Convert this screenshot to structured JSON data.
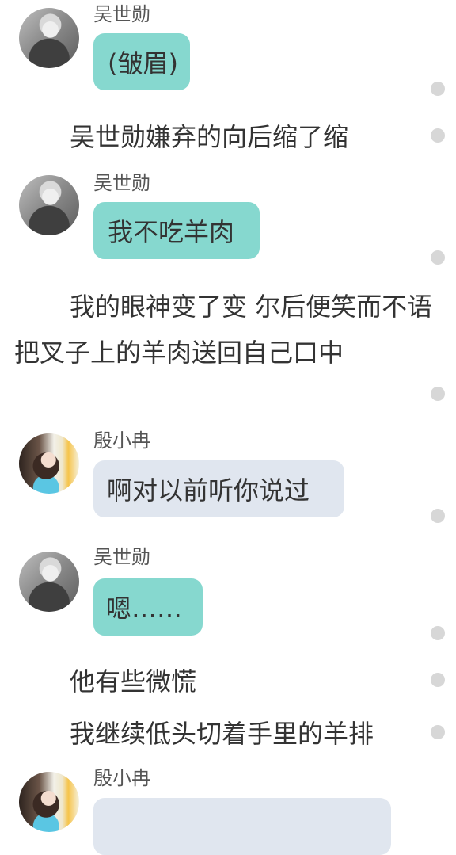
{
  "messages": [
    {
      "type": "chat",
      "speaker": "吴世勋",
      "text": "(皱眉)",
      "avatar_icon": "male-avatar-icon",
      "bubble_color": "#86d8cf"
    },
    {
      "type": "narration",
      "text": "吴世勋嫌弃的向后缩了缩"
    },
    {
      "type": "chat",
      "speaker": "吴世勋",
      "text": "我不吃羊肉",
      "avatar_icon": "male-avatar-icon",
      "bubble_color": "#86d8cf"
    },
    {
      "type": "narration",
      "text": "我的眼神变了变 尔后便笑而不语把叉子上的羊肉送回自己口中"
    },
    {
      "type": "chat",
      "speaker": "殷小冉",
      "text": "啊对以前听你说过",
      "avatar_icon": "female-avatar-icon",
      "bubble_color": "#e0e6ef"
    },
    {
      "type": "chat",
      "speaker": "吴世勋",
      "text": "嗯……",
      "avatar_icon": "male-avatar-icon",
      "bubble_color": "#86d8cf"
    },
    {
      "type": "narration",
      "text": "他有些微慌"
    },
    {
      "type": "narration",
      "text": "我继续低头切着手里的羊排"
    },
    {
      "type": "chat",
      "speaker": "殷小冉",
      "text": "",
      "avatar_icon": "female-avatar-icon",
      "bubble_color": "#e0e6ef"
    }
  ],
  "ui": {
    "scroll_indicator_icon": "gray-dot-icon",
    "scroll_indicator_color": "#d7d7d7"
  }
}
